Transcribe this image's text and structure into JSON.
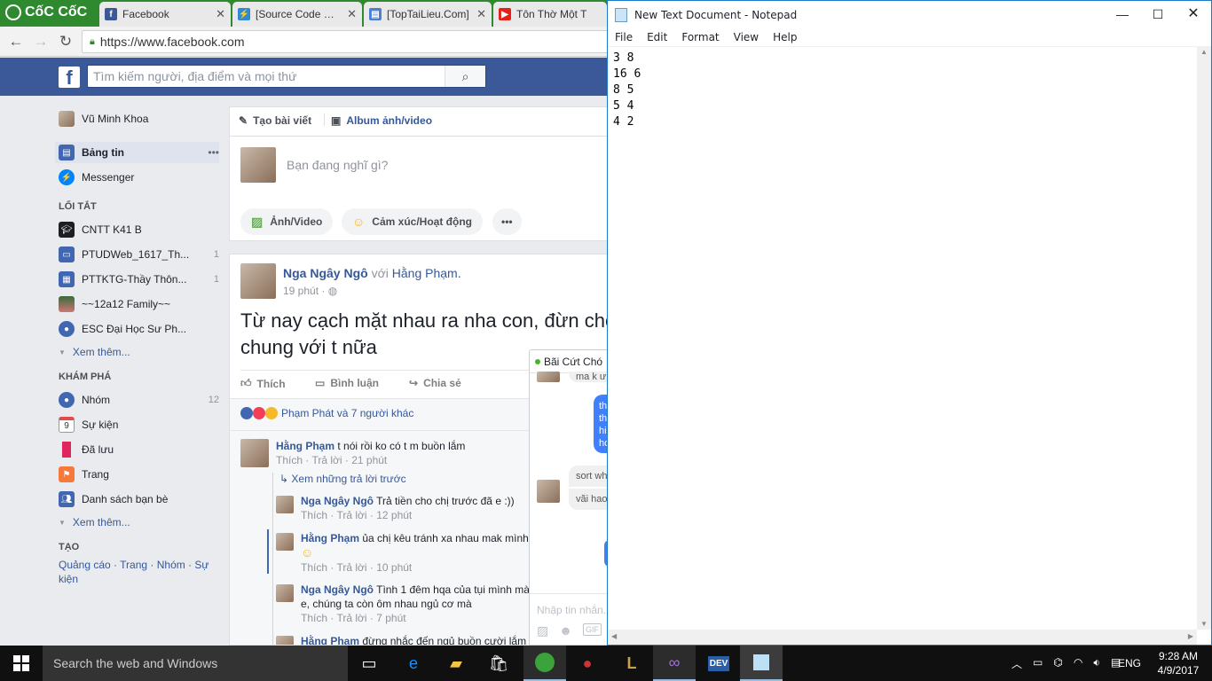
{
  "browser": {
    "brand": "CốC CốC",
    "tabs": [
      {
        "label": "Facebook",
        "icon": "facebook-icon"
      },
      {
        "label": "[Source Code C] T",
        "icon": "bolt-icon"
      },
      {
        "label": "[TopTaiLieu.Com]",
        "icon": "document-icon"
      },
      {
        "label": "Tôn Thờ Một T",
        "icon": "youtube-icon"
      }
    ],
    "url": "https://www.facebook.com"
  },
  "facebook": {
    "search_placeholder": "Tìm kiếm người, địa điểm và mọi thứ",
    "user": "Vũ Minh Khoa",
    "nav": [
      {
        "label": "Bảng tin",
        "icon": "news-feed-icon",
        "count": ""
      },
      {
        "label": "Messenger",
        "icon": "messenger-icon",
        "count": ""
      }
    ],
    "shortcuts_title": "LỐI TẮT",
    "shortcuts": [
      {
        "label": "CNTT K41 B",
        "icon": "graduation-cap-icon",
        "count": ""
      },
      {
        "label": "PTUDWeb_1617_Th...",
        "icon": "book-icon",
        "count": "1"
      },
      {
        "label": "PTTKTG-Thầy Thôn...",
        "icon": "grid-icon",
        "count": "1"
      },
      {
        "label": "~~12a12 Family~~",
        "icon": "landscape-icon",
        "count": ""
      },
      {
        "label": "ESC Đại Học Sư Ph...",
        "icon": "group-icon",
        "count": ""
      }
    ],
    "see_more": "Xem thêm...",
    "explore_title": "KHÁM PHÁ",
    "explore": [
      {
        "label": "Nhóm",
        "icon": "groups-icon",
        "count": "12"
      },
      {
        "label": "Sự kiện",
        "icon": "calendar-icon",
        "count": ""
      },
      {
        "label": "Đã lưu",
        "icon": "bookmark-icon",
        "count": ""
      },
      {
        "label": "Trang",
        "icon": "flag-icon",
        "count": ""
      },
      {
        "label": "Danh sách bạn bè",
        "icon": "friends-list-icon",
        "count": ""
      }
    ],
    "calendar_day": "9",
    "create_title": "TẠO",
    "create_links": "Quảng cáo · Trang · Nhóm · Sự kiện",
    "composer": {
      "tab_post": "Tạo bài viết",
      "tab_album": "Album ảnh/video",
      "placeholder": "Bạn đang nghĩ gì?",
      "photo": "Ảnh/Video",
      "feeling": "Cảm xúc/Hoạt động",
      "more": "•••"
    },
    "post": {
      "author": "Nga Ngây Ngô",
      "with_text": "với",
      "with_name": "Hằng Phạm.",
      "time": "19 phút",
      "text": "Từ nay cạch mặt nhau ra nha con, đừn chơi chung với t nữa",
      "like": "Thích",
      "comment": "Bình luận",
      "share": "Chia sẻ",
      "reactions": "Phạm Phát và 7 người khác",
      "view_prev": "Xem những trả lời trước",
      "comments": [
        {
          "author": "Hằng Phạm",
          "text": "t nói rồi ko có t m buồn lắm",
          "meta": "Thích · Trả lời · 21 phút"
        },
        {
          "author": "Nga Ngây Ngô",
          "text": "Trả tiền cho chị trước đã e :))",
          "meta": "Thích · Trả lời · 12 phút"
        },
        {
          "author": "Hằng Phạm",
          "text": "ủa chị kêu tránh xa nhau mak mình",
          "meta": "Thích · Trả lời · 10 phút"
        },
        {
          "author": "Nga Ngây Ngô",
          "text": "Tình 1 đêm hqa của tụi mình mà e, chúng ta còn ôm nhau ngủ cơ mà",
          "meta": "Thích · Trả lời · 7 phút"
        },
        {
          "author": "Hằng Phạm",
          "text": "đừng nhắc đến ngủ buồn cười lắm",
          "meta": ""
        }
      ]
    },
    "chat": {
      "title": "Bãi Cứt Chó",
      "msg1": "ma k ư",
      "msg2": "th th hi hơ",
      "msg3": "sort wh",
      "msg4": "vãi hao",
      "input_placeholder": "Nhập tin nhắn..."
    }
  },
  "notepad": {
    "title": "New Text Document - Notepad",
    "menu": [
      "File",
      "Edit",
      "Format",
      "View",
      "Help"
    ],
    "content": "3 8\n16 6\n8 5\n5 4\n4 2"
  },
  "taskbar": {
    "search": "Search the web and Windows",
    "lang": "ENG",
    "time": "9:28 AM",
    "date": "4/9/2017"
  }
}
